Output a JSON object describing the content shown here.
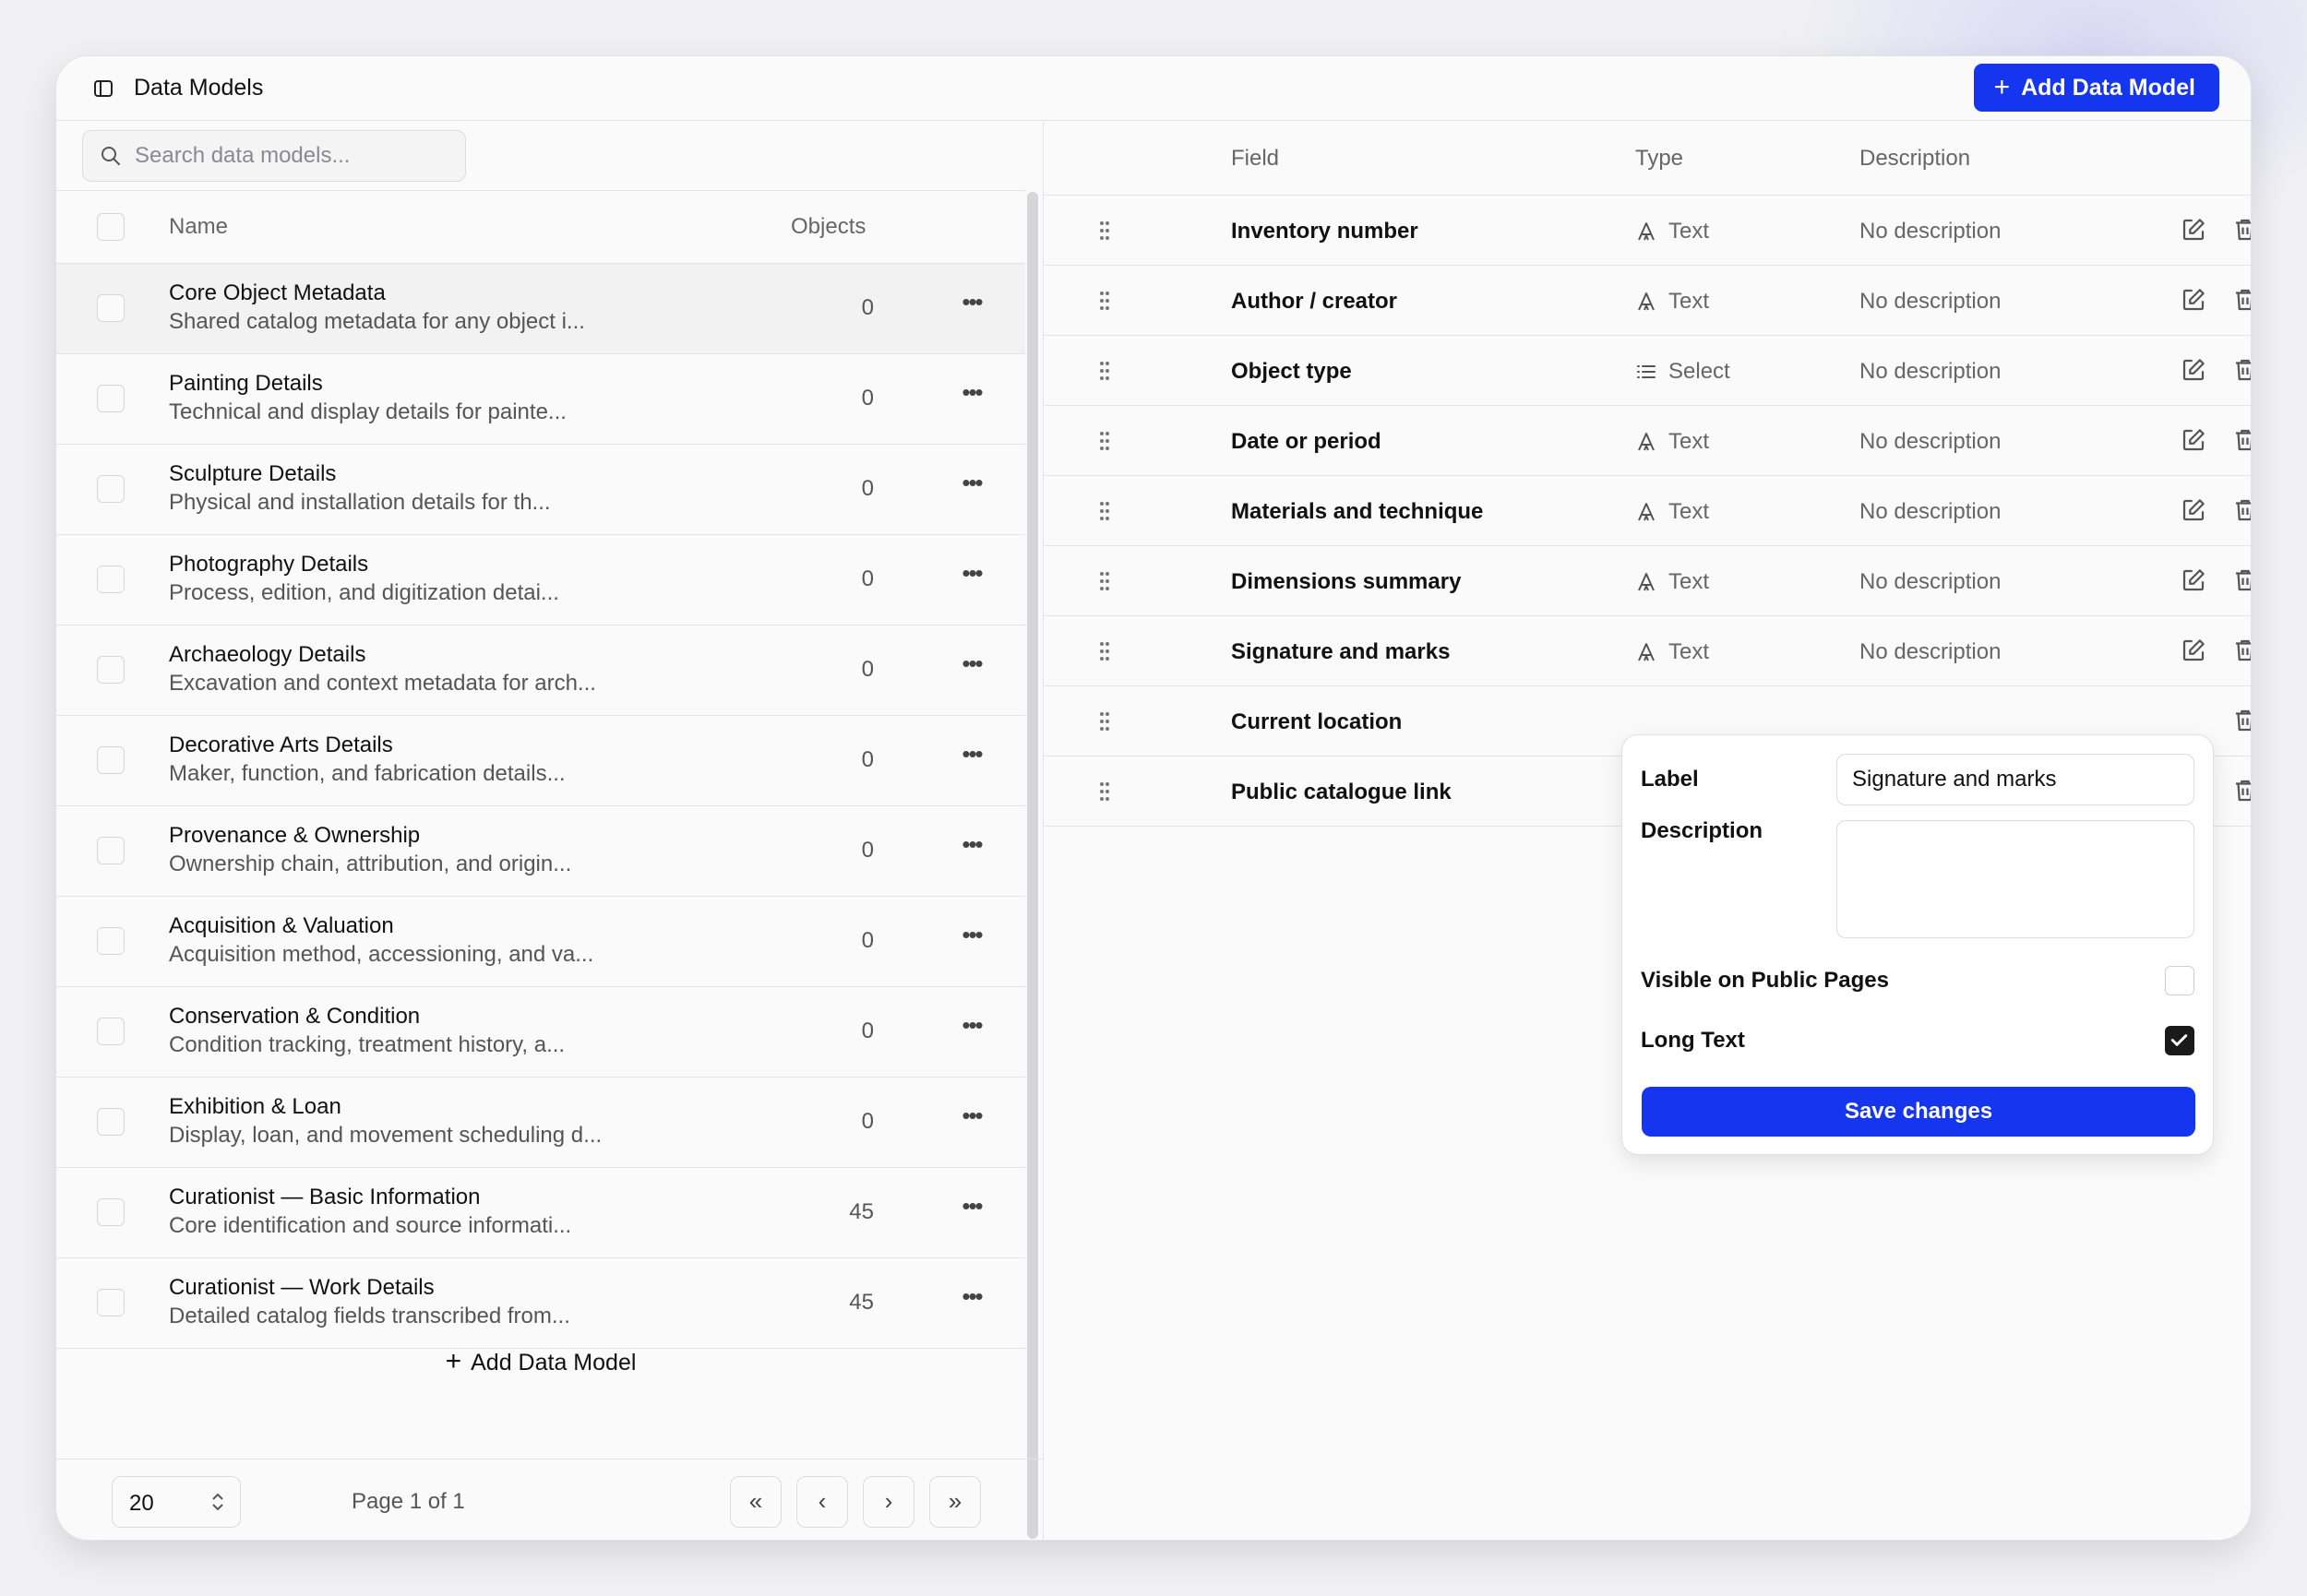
{
  "header": {
    "title": "Data Models",
    "add_button_label": "Add Data Model"
  },
  "search": {
    "placeholder": "Search data models..."
  },
  "models_table": {
    "columns": {
      "name": "Name",
      "objects": "Objects"
    },
    "rows": [
      {
        "name": "Core Object Metadata",
        "description": "Shared catalog metadata for any object i...",
        "objects": "0"
      },
      {
        "name": "Painting Details",
        "description": "Technical and display details for painte...",
        "objects": "0"
      },
      {
        "name": "Sculpture Details",
        "description": "Physical and installation details for th...",
        "objects": "0"
      },
      {
        "name": "Photography Details",
        "description": "Process, edition, and digitization detai...",
        "objects": "0"
      },
      {
        "name": "Archaeology Details",
        "description": "Excavation and context metadata for arch...",
        "objects": "0"
      },
      {
        "name": "Decorative Arts Details",
        "description": "Maker, function, and fabrication details...",
        "objects": "0"
      },
      {
        "name": "Provenance & Ownership",
        "description": "Ownership chain, attribution, and origin...",
        "objects": "0"
      },
      {
        "name": "Acquisition & Valuation",
        "description": "Acquisition method, accessioning, and va...",
        "objects": "0"
      },
      {
        "name": "Conservation & Condition",
        "description": "Condition tracking, treatment history, a...",
        "objects": "0"
      },
      {
        "name": "Exhibition & Loan",
        "description": "Display, loan, and movement scheduling d...",
        "objects": "0"
      },
      {
        "name": "Curationist — Basic Information",
        "description": "Core identification and source informati...",
        "objects": "45"
      },
      {
        "name": "Curationist — Work Details",
        "description": "Detailed catalog fields transcribed from...",
        "objects": "45"
      }
    ],
    "add_row_label": "Add Data Model"
  },
  "pagination": {
    "page_size": "20",
    "page_info": "Page 1 of 1",
    "first_icon": "«",
    "prev_icon": "‹",
    "next_icon": "›",
    "last_icon": "»"
  },
  "fields_table": {
    "columns": {
      "field": "Field",
      "type": "Type",
      "description": "Description"
    },
    "rows": [
      {
        "field": "Inventory number",
        "type": "Text",
        "type_icon": "text-type-icon",
        "description": "No description"
      },
      {
        "field": "Author / creator",
        "type": "Text",
        "type_icon": "text-type-icon",
        "description": "No description"
      },
      {
        "field": "Object type",
        "type": "Select",
        "type_icon": "list-icon",
        "description": "No description"
      },
      {
        "field": "Date or period",
        "type": "Text",
        "type_icon": "text-type-icon",
        "description": "No description"
      },
      {
        "field": "Materials and technique",
        "type": "Text",
        "type_icon": "text-type-icon",
        "description": "No description"
      },
      {
        "field": "Dimensions summary",
        "type": "Text",
        "type_icon": "text-type-icon",
        "description": "No description"
      },
      {
        "field": "Signature and marks",
        "type": "Text",
        "type_icon": "text-type-icon",
        "description": "No description"
      },
      {
        "field": "Current location",
        "type": "",
        "type_icon": "",
        "description": ""
      },
      {
        "field": "Public catalogue link",
        "type": "",
        "type_icon": "",
        "description": ""
      }
    ]
  },
  "edit_popover": {
    "label_label": "Label",
    "label_value": "Signature and marks",
    "description_label": "Description",
    "description_value": "",
    "visible_label": "Visible on Public Pages",
    "visible_checked": false,
    "long_text_label": "Long Text",
    "long_text_checked": true,
    "save_label": "Save changes"
  },
  "colors": {
    "accent": "#1535ee",
    "background": "#fafafa",
    "border": "#e3e3e6"
  }
}
